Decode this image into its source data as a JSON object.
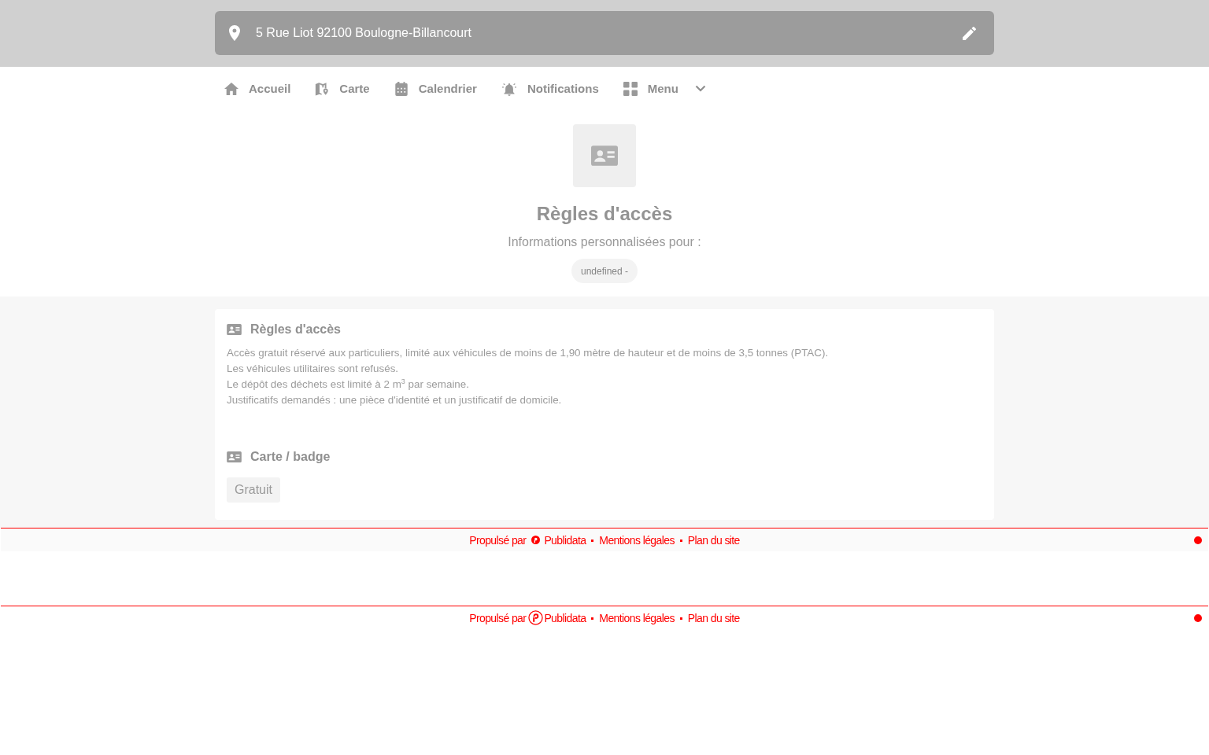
{
  "address_bar": {
    "address": "5 Rue Liot 92100 Boulogne-Billancourt"
  },
  "nav": {
    "items": [
      {
        "label": "Accueil",
        "kind": "home",
        "dropdown": false
      },
      {
        "label": "Carte",
        "kind": "map",
        "dropdown": false
      },
      {
        "label": "Calendrier",
        "kind": "calendar",
        "dropdown": false
      },
      {
        "label": "Notifications",
        "kind": "bell",
        "dropdown": false
      },
      {
        "label": "Menu",
        "kind": "grid",
        "dropdown": true
      }
    ]
  },
  "hero": {
    "title": "Règles d'accès",
    "subtitle": "Informations personnalisées pour :",
    "pill": "undefined -"
  },
  "card": {
    "sections": [
      {
        "kind": "text",
        "title": "Règles d'accès",
        "lines": [
          "Accès gratuit réservé aux particuliers, limité aux véhicules de moins de 1,90 mètre de hauteur et de moins de 3,5 tonnes (PTAC).",
          "Les véhicules utilitaires sont refusés.",
          "Le dépôt des déchets est limité à 2 m$^{3}$ par semaine.",
          "Justificatifs demandés : une pièce d'identité et un justificatif de domicile."
        ]
      },
      {
        "kind": "tag",
        "title": "Carte / badge",
        "tag": "Gratuit"
      }
    ]
  },
  "footers": [
    {
      "kind": "page",
      "powered_by": "Propulsé par",
      "brand": "Publidata",
      "links": [
        "Mentions légales",
        "Plan du site"
      ]
    },
    {
      "kind": "plain",
      "powered_by": "Propulsé par",
      "brand": "Publidata",
      "links": [
        "Mentions légales",
        "Plan du site"
      ]
    }
  ]
}
